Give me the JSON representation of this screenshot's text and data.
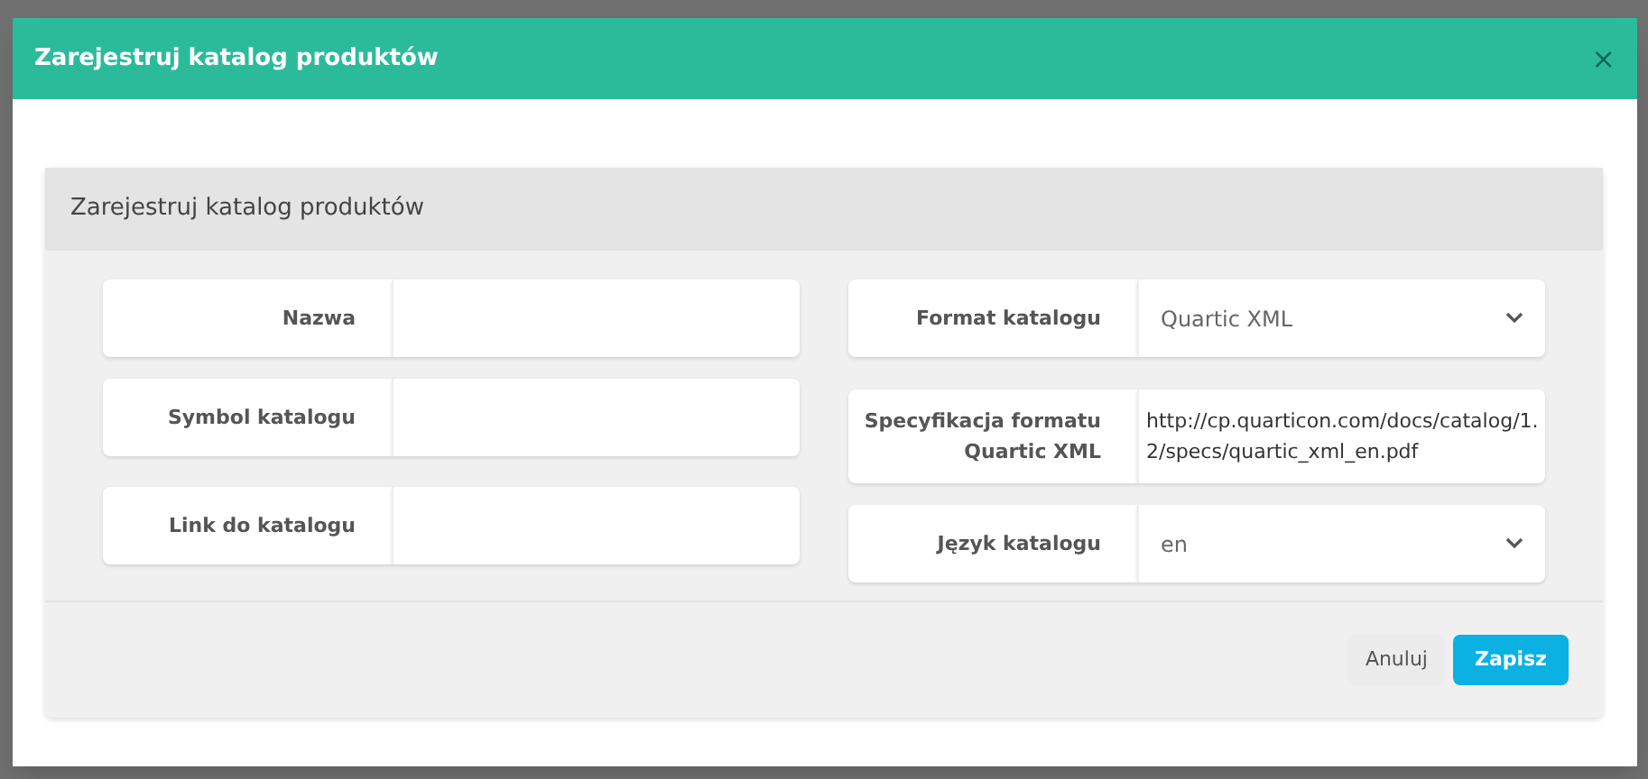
{
  "dialog": {
    "title": "Zarejestruj katalog produktów",
    "close": "×"
  },
  "panel": {
    "title": "Zarejestruj katalog produktów"
  },
  "left_fields": [
    {
      "kind": "text",
      "label": "Nazwa"
    },
    {
      "kind": "text",
      "label": "Symbol katalogu"
    },
    {
      "kind": "text",
      "label": "Link do katalogu"
    }
  ],
  "right_fields": [
    {
      "kind": "select",
      "label": "Format katalogu",
      "value": "Quartic XML"
    },
    {
      "kind": "static",
      "label": "Specyfikacja formatu Quartic XML",
      "value": "http://cp.quarticon.com/docs/catalog/1.2/specs/quartic_xml_en.pdf"
    },
    {
      "kind": "select",
      "label": "Język katalogu",
      "value": "en"
    }
  ],
  "buttons": [
    {
      "kind": "secondary",
      "label": "Anuluj"
    },
    {
      "kind": "primary",
      "label": "Zapisz"
    }
  ]
}
